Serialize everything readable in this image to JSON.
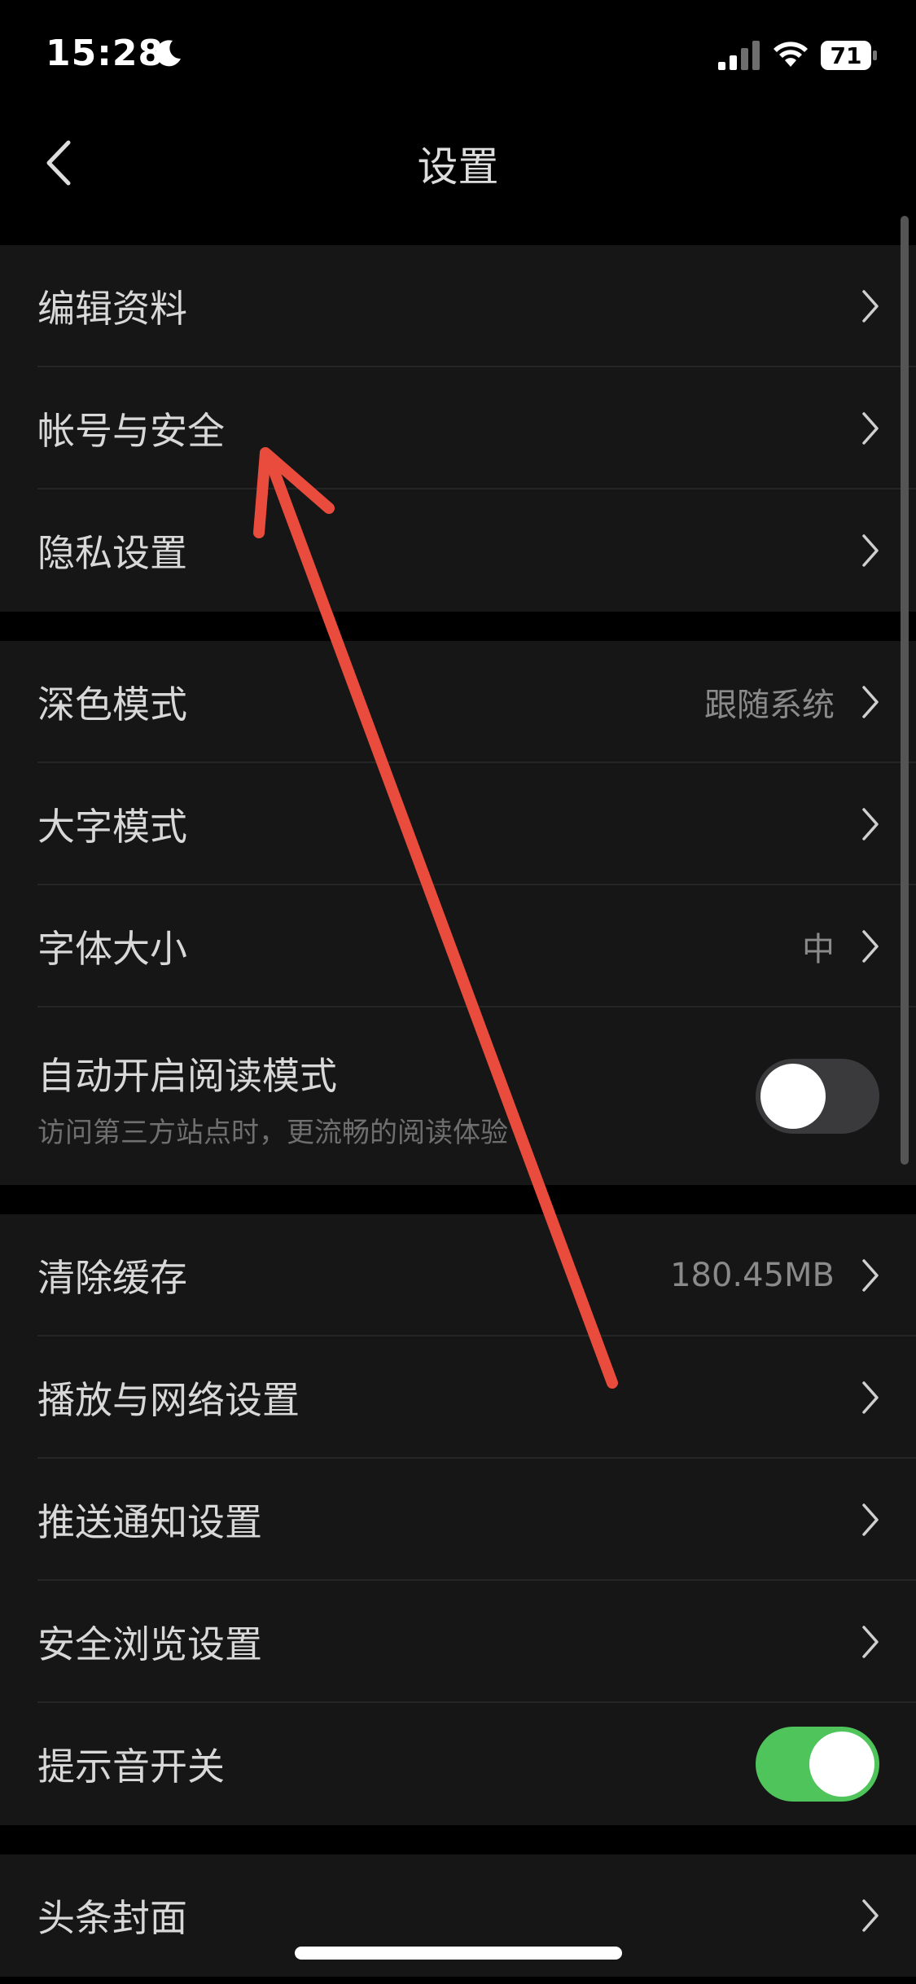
{
  "status_bar": {
    "time": "15:28",
    "battery": "71"
  },
  "nav": {
    "title": "设置"
  },
  "colors": {
    "toggle_on": "#4ec45a",
    "annotation_arrow": "#e94b3c"
  },
  "groups": [
    {
      "items": [
        {
          "label": "编辑资料"
        },
        {
          "label": "帐号与安全"
        },
        {
          "label": "隐私设置"
        }
      ]
    },
    {
      "items": [
        {
          "label": "深色模式",
          "value": "跟随系统"
        },
        {
          "label": "大字模式"
        },
        {
          "label": "字体大小",
          "value": "中"
        },
        {
          "label": "自动开启阅读模式",
          "sub": "访问第三方站点时，更流畅的阅读体验",
          "toggle": "off"
        }
      ]
    },
    {
      "items": [
        {
          "label": "清除缓存",
          "value": "180.45MB"
        },
        {
          "label": "播放与网络设置"
        },
        {
          "label": "推送通知设置"
        },
        {
          "label": "安全浏览设置"
        },
        {
          "label": "提示音开关",
          "toggle": "on"
        }
      ]
    },
    {
      "items": [
        {
          "label": "头条封面"
        }
      ]
    }
  ]
}
